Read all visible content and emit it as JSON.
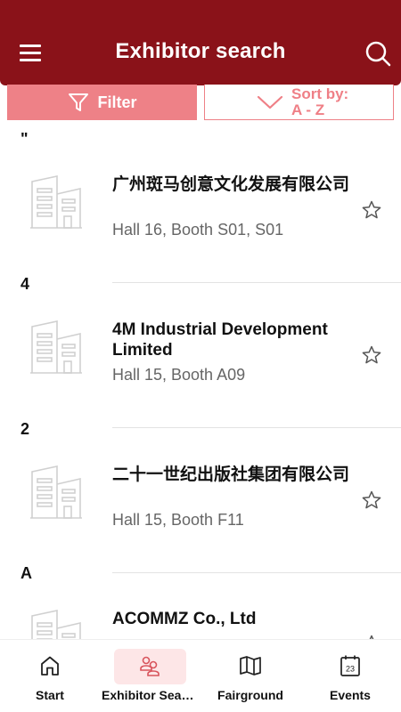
{
  "header": {
    "title": "Exhibitor search",
    "menu_icon": "hamburger-menu-icon",
    "search_icon": "search-icon"
  },
  "controls": {
    "filter_label": "Filter",
    "sort_line1": "Sort by:",
    "sort_line2": "A - Z"
  },
  "sections": [
    {
      "letter": "\"",
      "items": [
        {
          "name": "广州斑马创意文化发展有限公司",
          "booth": "Hall 16, Booth S01, S01",
          "favorite": false
        }
      ]
    },
    {
      "letter": "4",
      "items": [
        {
          "name": "4M Industrial Development Limited",
          "booth": "Hall 15, Booth A09",
          "favorite": false
        }
      ]
    },
    {
      "letter": "2",
      "items": [
        {
          "name": "二十一世纪出版社集团有限公司",
          "booth": "Hall 15, Booth F11",
          "favorite": false
        }
      ]
    },
    {
      "letter": "A",
      "items": [
        {
          "name": "ACOMMZ Co., Ltd",
          "booth": "",
          "favorite": false
        }
      ]
    }
  ],
  "bottom_nav": {
    "items": [
      {
        "label": "Start",
        "icon": "home-icon"
      },
      {
        "label": "Exhibitor Search",
        "icon": "exhibitors-icon",
        "active": true
      },
      {
        "label": "Fairground",
        "icon": "map-icon"
      },
      {
        "label": "Events",
        "icon": "calendar-icon",
        "calendar_day": "23"
      }
    ]
  },
  "colors": {
    "header_bg": "#8a1219",
    "accent": "#ee8187",
    "active_tab_bg": "#fde6e7"
  }
}
